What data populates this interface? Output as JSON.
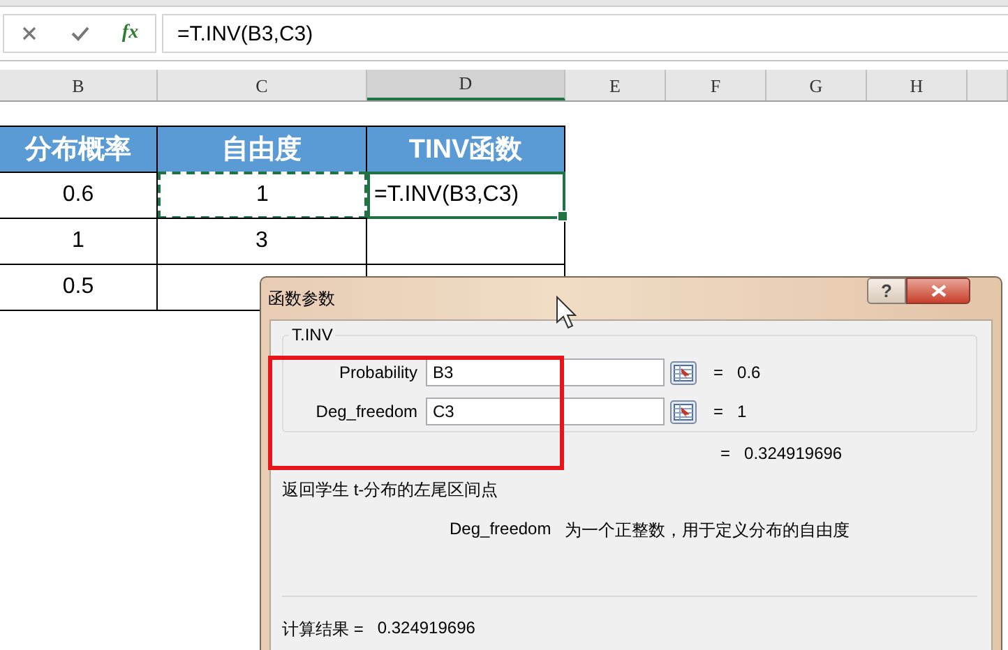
{
  "formula_bar": {
    "function_label": "fx",
    "formula": "=T.INV(B3,C3)"
  },
  "columns": [
    {
      "label": "B",
      "selected": false
    },
    {
      "label": "C",
      "selected": false
    },
    {
      "label": "D",
      "selected": true
    },
    {
      "label": "E",
      "selected": false
    },
    {
      "label": "F",
      "selected": false
    },
    {
      "label": "G",
      "selected": false
    },
    {
      "label": "H",
      "selected": false
    }
  ],
  "table": {
    "header": [
      "分布概率",
      "自由度",
      "TINV函数"
    ],
    "rows": [
      {
        "cells": [
          {
            "text": "0.6",
            "copied": false,
            "active": false
          },
          {
            "text": "1",
            "copied": true,
            "active": false
          },
          {
            "text": "=T.INV(B3,C3)",
            "copied": false,
            "active": true
          }
        ]
      },
      {
        "cells": [
          {
            "text": "1",
            "copied": false,
            "active": false
          },
          {
            "text": "3",
            "copied": false,
            "active": false
          },
          {
            "copied": false,
            "active": false
          }
        ]
      },
      {
        "cells": [
          {
            "text": "0.5",
            "copied": false,
            "active": false
          },
          {
            "copied": false,
            "active": false
          },
          {
            "copied": false,
            "active": false
          }
        ]
      }
    ]
  },
  "dialog": {
    "title": "函数参数",
    "help": "?",
    "function_name": "T.INV",
    "arguments": [
      {
        "name": "Probability",
        "value": "B3",
        "equals": "=",
        "result": "0.6"
      },
      {
        "name": "Deg_freedom",
        "value": "C3",
        "equals": "=",
        "result": "1"
      }
    ],
    "formula_result": {
      "equals": "=",
      "value": "0.324919696"
    },
    "description": "返回学生 t-分布的左尾区间点",
    "argument_help": {
      "name": "Deg_freedom",
      "text": "为一个正整数，用于定义分布的自由度"
    },
    "computed": {
      "label": "计算结果 =",
      "value": "0.324919696"
    },
    "annotation": {
      "kind": "rectangle"
    }
  }
}
